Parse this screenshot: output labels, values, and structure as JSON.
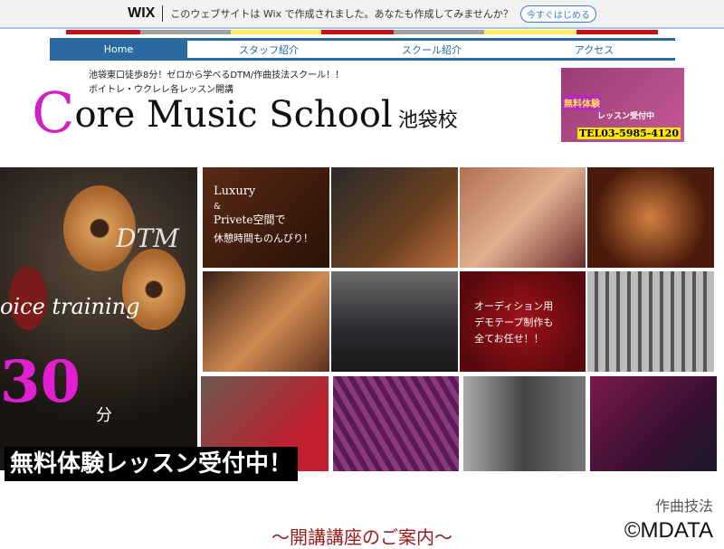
{
  "wix_bar": {
    "logo": "WIX",
    "message": "このウェブサイトは Wix で作成されました。あなたも作成してみませんか？",
    "cta": "今すぐはじめる"
  },
  "nav": {
    "items": [
      "Home",
      "スタッフ紹介",
      "スクール紹介",
      "アクセス"
    ],
    "active": "Home"
  },
  "header": {
    "tagline1": "池袋東口徒歩8分！ゼロから学べるDTM/作曲技法スクール！！",
    "tagline2": "ボイトレ・ウクレレ各レッスン開講",
    "title_initial": "C",
    "title_rest": "ore Music School",
    "title_sub": "池袋校"
  },
  "promo": {
    "badge": "無料体験",
    "text": "レッスン受付中",
    "tel": "TEL03-5985-4120"
  },
  "hero": {
    "dtm": "DTM",
    "voice": "oice training",
    "minutes": "30",
    "minutes_unit": "分",
    "banner": "無料体験レッスン受付中！"
  },
  "grid": {
    "luxury": "Luxury",
    "amp": "&",
    "privete": "Privete空間で",
    "relax": "休憩時間ものんびり！",
    "audition1": "オーディション用",
    "audition2": "デモテープ制作も",
    "audition3": "全てお任せ！！"
  },
  "intro": "～開講講座のご案内～",
  "watermark": {
    "top": "作曲技法",
    "brand": "©MDATA"
  },
  "colors": {
    "nav": "#2a6aa0",
    "accent": "#d020c0",
    "intro": "#9b1a1a"
  }
}
